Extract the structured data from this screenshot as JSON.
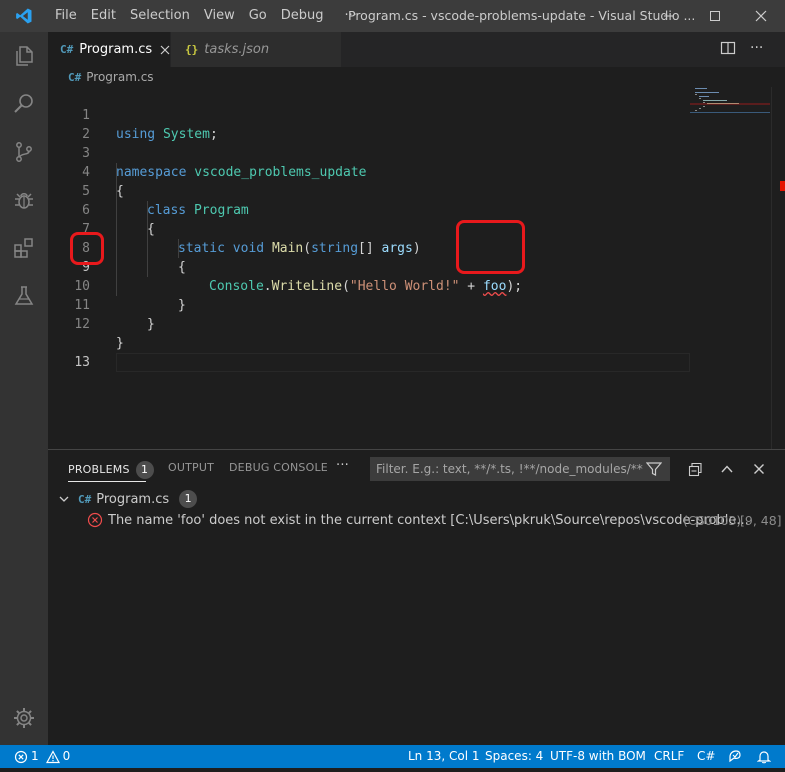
{
  "titlebar": {
    "menu": [
      "File",
      "Edit",
      "Selection",
      "View",
      "Go",
      "Debug"
    ],
    "more": "···",
    "window_title": "Program.cs - vscode-problems-update - Visual Studio ..."
  },
  "tabs": [
    {
      "label": "Program.cs",
      "badge": "C#"
    },
    {
      "label": "tasks.json",
      "badge": "{}"
    }
  ],
  "breadcrumb": {
    "file": "Program.cs"
  },
  "editor": {
    "line_numbers": [
      "1",
      "2",
      "3",
      "4",
      "5",
      "6",
      "7",
      "8",
      "9",
      "10",
      "11",
      "12",
      "13"
    ],
    "tokens": {
      "l1_using": "using",
      "l1_system": "System",
      "l1_semi": ";",
      "l3_namespace": "namespace",
      "l3_name": "vscode_problems_update",
      "open_brace": "{",
      "close_brace": "}",
      "l5_class": "class",
      "l5_name": "Program",
      "l7_static": "static",
      "l7_void": "void",
      "l7_main": "Main",
      "l7_paren": "(",
      "l7_string": "string",
      "l7_brackets": "[] ",
      "l7_args": "args",
      "l7_close": ")",
      "l9_console": "Console",
      "l9_dot": ".",
      "l9_writeline": "WriteLine",
      "l9_paren": "(",
      "l9_str": "\"Hello World!\"",
      "l9_plus": " + ",
      "l9_foo": "foo",
      "l9_end": ");"
    }
  },
  "panel": {
    "tabs": [
      {
        "label": "PROBLEMS",
        "count": "1"
      },
      {
        "label": "OUTPUT"
      },
      {
        "label": "DEBUG CONSOLE"
      }
    ],
    "more": "···",
    "filter_placeholder": "Filter. E.g.: text, **/*.ts, !**/node_modules/**",
    "problems": {
      "file": "Program.cs",
      "file_count": "1",
      "message": "The name 'foo' does not exist in the current context [C:\\Users\\pkruk\\Source\\repos\\vscode-proble...",
      "code": "(CS0103)",
      "position": "[9, 48]"
    }
  },
  "statusbar": {
    "errors": "1",
    "warnings": "0",
    "cursor": "Ln 13, Col 1",
    "spaces": "Spaces: 4",
    "encoding": "UTF-8 with BOM",
    "eol": "CRLF",
    "language": "C#"
  },
  "colors": {
    "accent": "#007acc",
    "error": "#f14c4c",
    "annotation": "#e8191c"
  }
}
